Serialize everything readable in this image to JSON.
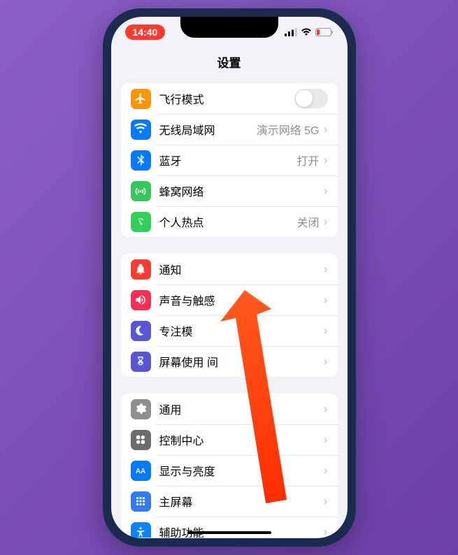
{
  "status": {
    "time": "14:40"
  },
  "header": {
    "title": "设置"
  },
  "groups": [
    {
      "rows": [
        {
          "icon": "airplane",
          "label": "飞行模式",
          "toggle": true
        },
        {
          "icon": "wifi",
          "label": "无线局域网",
          "value": "演示网络 5G"
        },
        {
          "icon": "bluetooth",
          "label": "蓝牙",
          "value": "打开"
        },
        {
          "icon": "cellular",
          "label": "蜂窝网络"
        },
        {
          "icon": "hotspot",
          "label": "个人热点",
          "value": "关闭"
        }
      ]
    },
    {
      "rows": [
        {
          "icon": "notifications",
          "label": "通知"
        },
        {
          "icon": "sound",
          "label": "声音与触感"
        },
        {
          "icon": "focus",
          "label": "专注模"
        },
        {
          "icon": "screentime",
          "label": "屏幕使用    间"
        }
      ]
    },
    {
      "rows": [
        {
          "icon": "general",
          "label": "通用"
        },
        {
          "icon": "control",
          "label": "控制中心"
        },
        {
          "icon": "display",
          "label": "显示与亮度"
        },
        {
          "icon": "home",
          "label": "主屏幕"
        },
        {
          "icon": "accessibility",
          "label": "辅助功能"
        }
      ]
    }
  ]
}
